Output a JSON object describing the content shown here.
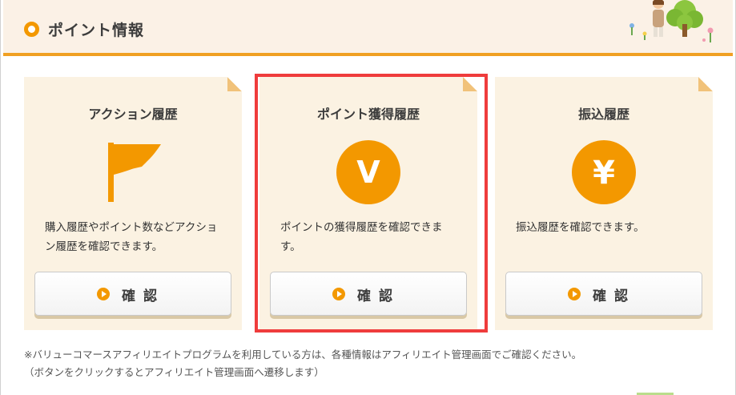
{
  "header": {
    "title": "ポイント情報"
  },
  "cards": [
    {
      "title": "アクション履歴",
      "icon": "flag-icon",
      "description": "購入履歴やポイント数などアクション履歴を確認できます。",
      "button_label": "確認"
    },
    {
      "title": "ポイント獲得履歴",
      "icon": "v-point-icon",
      "icon_glyph": "V",
      "description": "ポイントの獲得履歴を確認できます。",
      "button_label": "確認",
      "highlighted": true
    },
    {
      "title": "振込履歴",
      "icon": "yen-icon",
      "icon_glyph": "¥",
      "description": "振込履歴を確認できます。",
      "button_label": "確認"
    }
  ],
  "notes": {
    "line1": "※バリューコマースアフィリエイトプログラムを利用している方は、各種情報はアフィリエイト管理画面でご確認ください。",
    "line2": "（ボタンをクリックするとアフィリエイト管理画面へ遷移します）"
  },
  "colors": {
    "accent": "#f39800",
    "header_bg": "#fbf1e6",
    "card_bg": "#fbf2e2",
    "highlight": "#ef3c3c"
  }
}
